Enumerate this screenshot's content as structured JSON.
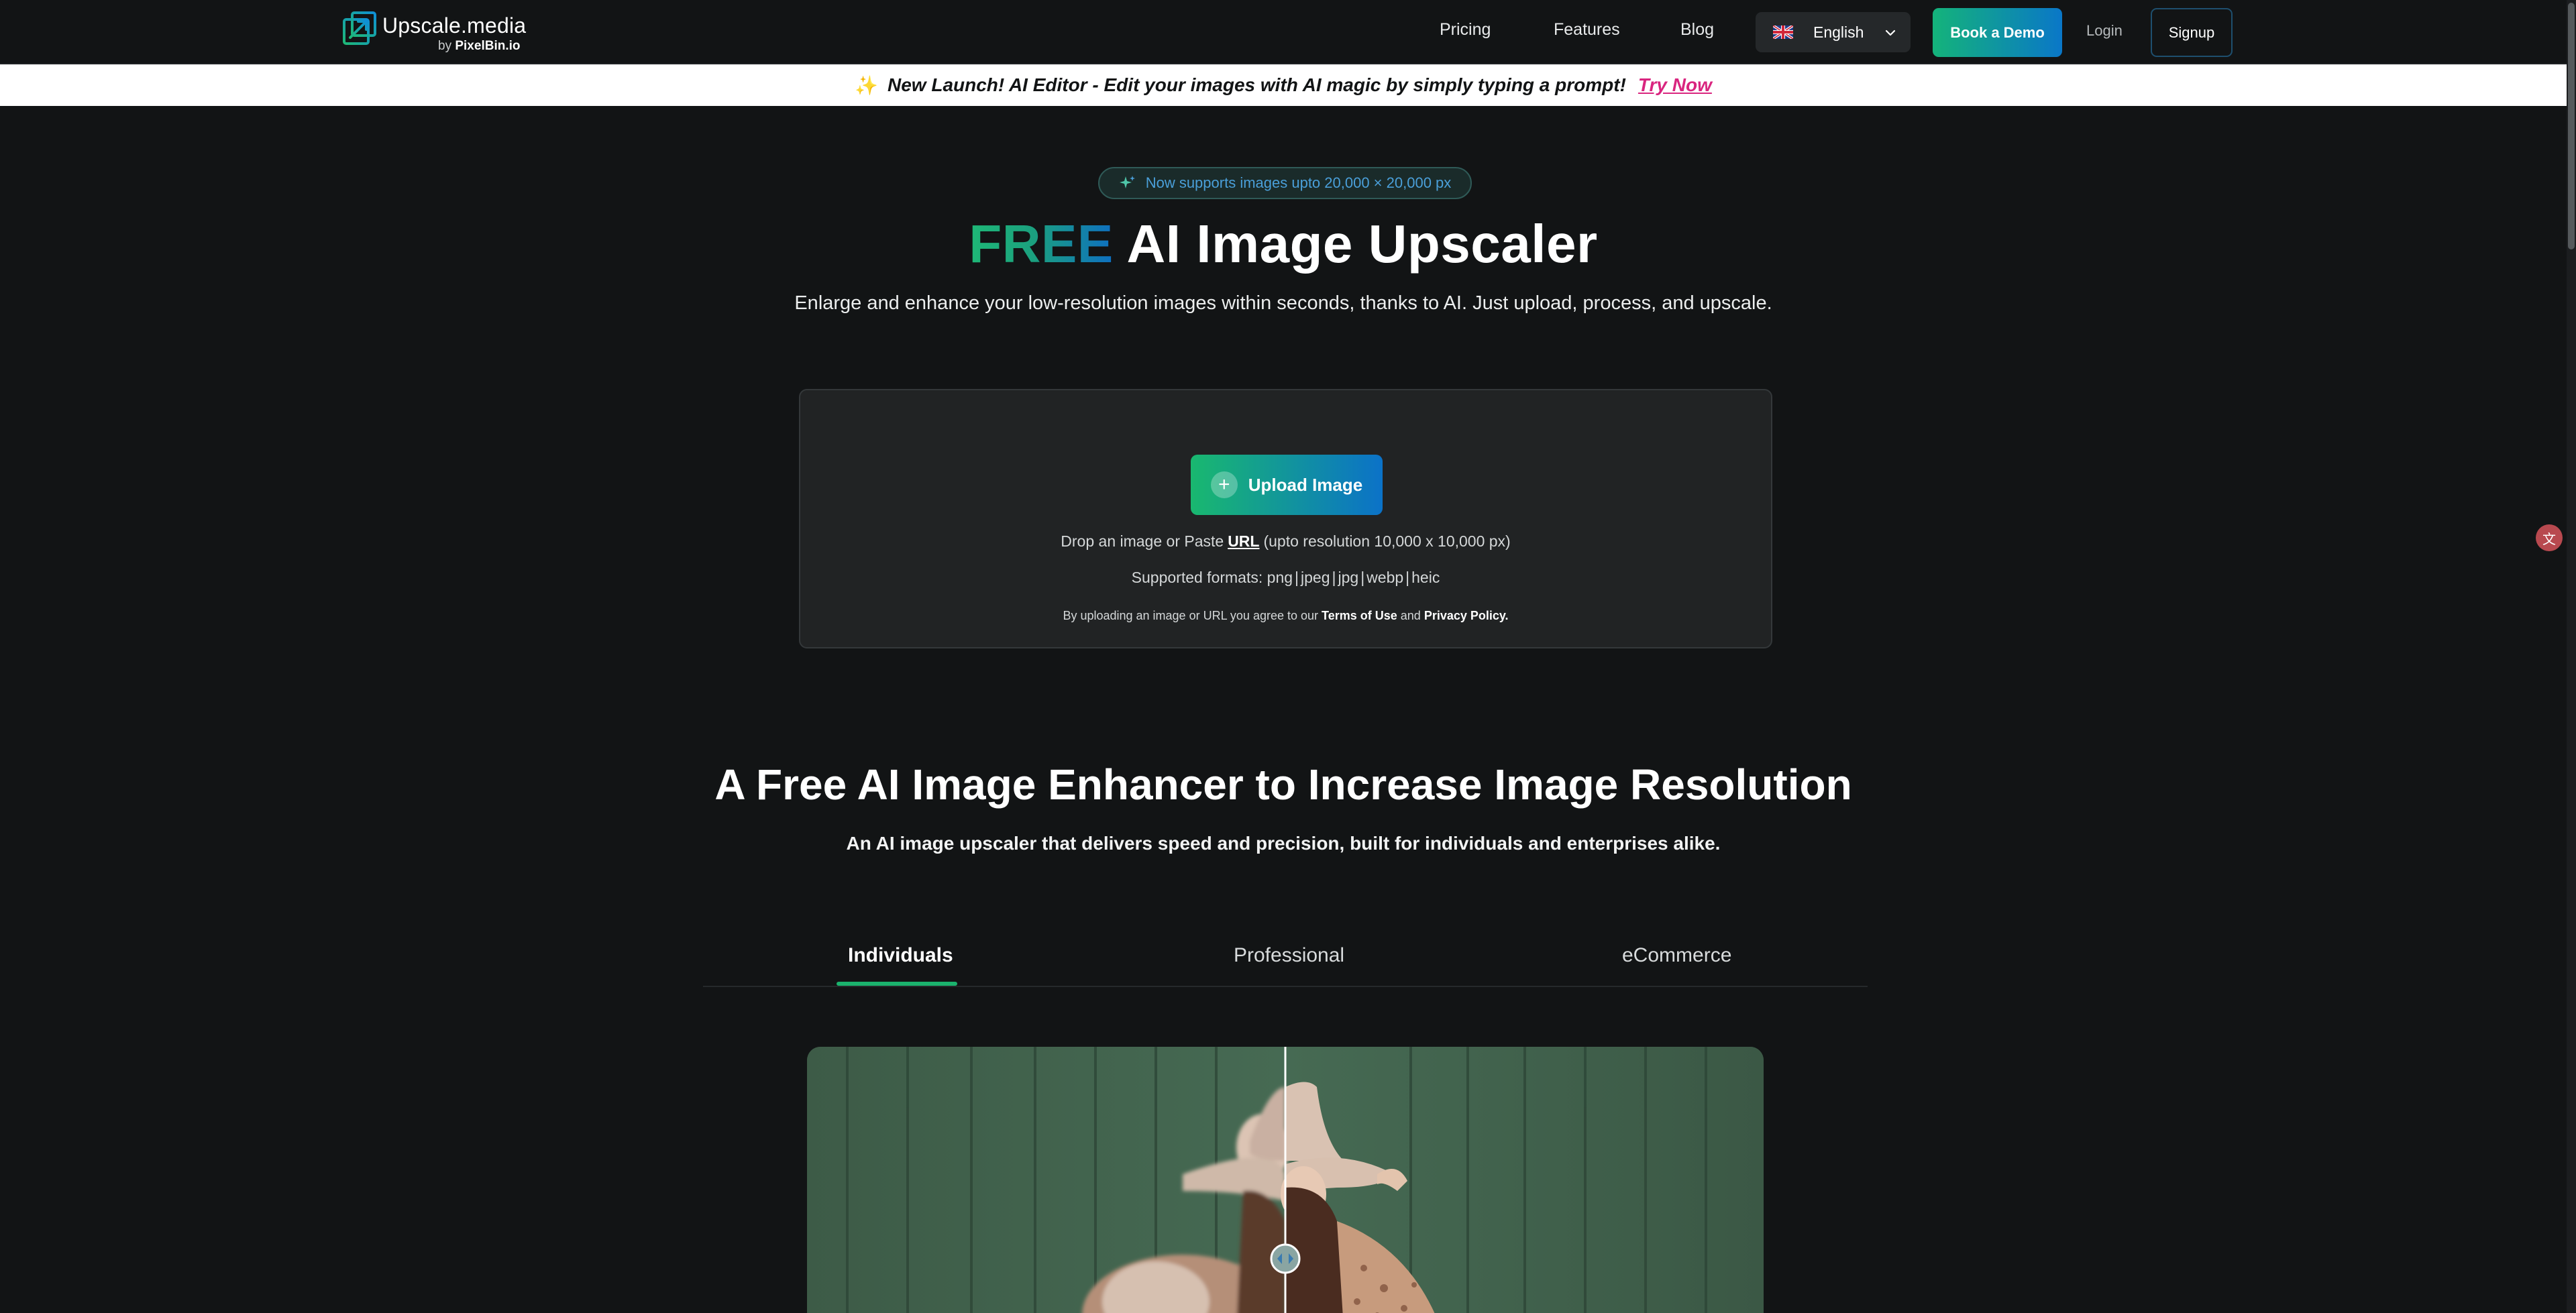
{
  "nav": {
    "brand": "Upscale.media",
    "brand_sub_prefix": "by",
    "brand_sub_name": "PixelBin.io",
    "links": [
      "Pricing",
      "Features",
      "Blog"
    ],
    "language": "English",
    "book_demo": "Book a Demo",
    "login": "Login",
    "signup": "Signup"
  },
  "announcement": {
    "text": "New Launch! AI Editor - Edit your images with AI magic by simply typing a prompt!",
    "cta": "Try Now"
  },
  "hero": {
    "badge": "Now supports images upto 20,000 × 20,000 px",
    "title_highlight": "FREE",
    "title_rest": "AI Image Upscaler",
    "subtitle": "Enlarge and enhance your low-resolution images within seconds, thanks to AI. Just upload, process, and upscale."
  },
  "upload": {
    "button": "Upload Image",
    "drop_prefix": "Drop an image or Paste",
    "drop_url": "URL",
    "drop_suffix": "(upto resolution 10,000 x 10,000 px)",
    "formats_label": "Supported formats:",
    "formats": [
      "png",
      "jpeg",
      "jpg",
      "webp",
      "heic"
    ],
    "terms_prefix": "By uploading an image or URL you agree to our",
    "terms_link": "Terms of Use",
    "terms_and": "and",
    "privacy_link": "Privacy Policy."
  },
  "section": {
    "title": "A Free AI Image Enhancer to Increase Image Resolution",
    "subtitle": "An AI image upscaler that delivers speed and precision, built for individuals and enterprises alike.",
    "tabs": [
      "Individuals",
      "Professional",
      "eCommerce"
    ],
    "active_tab": "Individuals"
  },
  "colors": {
    "background": "#121415",
    "accent_green": "#1bb26d",
    "accent_blue": "#0b72c8",
    "announce_cta": "#d9257f"
  }
}
